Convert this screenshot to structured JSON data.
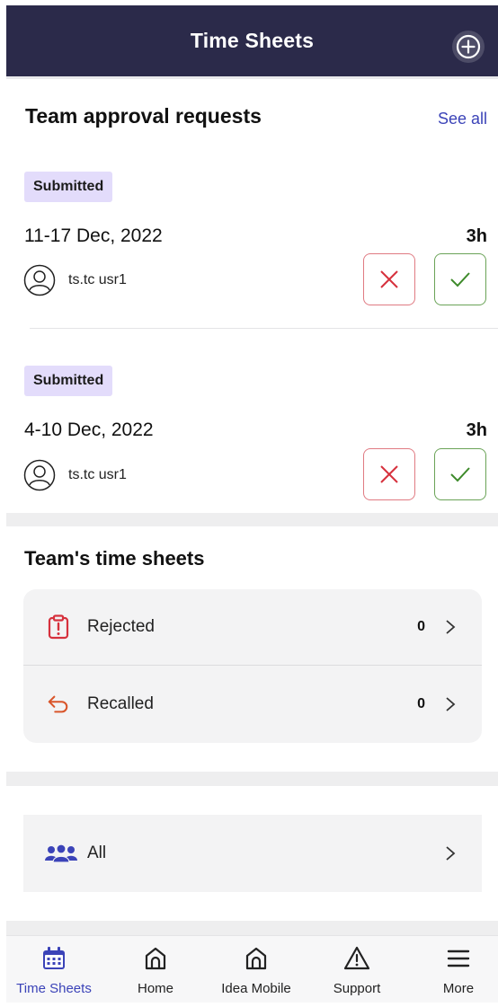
{
  "header": {
    "title": "Time Sheets",
    "add_icon": "plus-circle-icon"
  },
  "approvals": {
    "title": "Team approval requests",
    "see_all": "See all",
    "items": [
      {
        "status": "Submitted",
        "period": "11-17 Dec, 2022",
        "hours": "3h",
        "user": "ts.tc usr1"
      },
      {
        "status": "Submitted",
        "period": "4-10 Dec, 2022",
        "hours": "3h",
        "user": "ts.tc usr1"
      }
    ]
  },
  "team_sheets": {
    "title": "Team's time sheets",
    "rows": [
      {
        "label": "Rejected",
        "count": "0",
        "icon": "clipboard-alert-icon"
      },
      {
        "label": "Recalled",
        "count": "0",
        "icon": "undo-arrow-icon"
      }
    ]
  },
  "all": {
    "label": "All",
    "icon": "people-group-icon"
  },
  "tabs": [
    {
      "label": "Time Sheets",
      "icon": "calendar-icon",
      "active": true
    },
    {
      "label": "Home",
      "icon": "home-icon"
    },
    {
      "label": "Idea Mobile",
      "icon": "home-icon"
    },
    {
      "label": "Support",
      "icon": "warning-icon"
    },
    {
      "label": "More",
      "icon": "menu-icon"
    }
  ],
  "colors": {
    "header_bg": "#2b2a4a",
    "accent": "#3b43b8",
    "badge_bg": "#e3dcfb",
    "reject": "#d6313d",
    "approve": "#3d8a2a",
    "recalled": "#d9552a"
  }
}
